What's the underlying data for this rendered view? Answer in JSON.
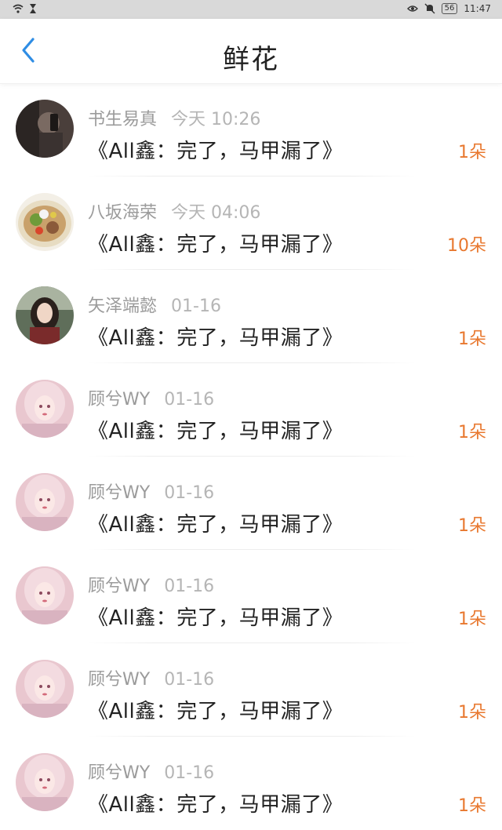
{
  "status_bar": {
    "time": "11:47",
    "battery": "56"
  },
  "navbar": {
    "title": "鲜花"
  },
  "colors": {
    "accent_blue": "#2f8de4",
    "amount_orange": "#e8782f"
  },
  "items": [
    {
      "name": "书生易真",
      "time": "今天 10:26",
      "content": "《All鑫：完了，马甲漏了》",
      "amount": "1朵",
      "avatar": "avatar-dark-portrait"
    },
    {
      "name": "八坂海荣",
      "time": "今天 04:06",
      "content": "《All鑫：完了，马甲漏了》",
      "amount": "10朵",
      "avatar": "avatar-food-plate"
    },
    {
      "name": "矢泽端懿",
      "time": "01-16",
      "content": "《All鑫：完了，马甲漏了》",
      "amount": "1朵",
      "avatar": "avatar-girl-portrait"
    },
    {
      "name": "顾兮WY",
      "time": "01-16",
      "content": "《All鑫：完了，马甲漏了》",
      "amount": "1朵",
      "avatar": "avatar-pink-illustration"
    },
    {
      "name": "顾兮WY",
      "time": "01-16",
      "content": "《All鑫：完了，马甲漏了》",
      "amount": "1朵",
      "avatar": "avatar-pink-illustration"
    },
    {
      "name": "顾兮WY",
      "time": "01-16",
      "content": "《All鑫：完了，马甲漏了》",
      "amount": "1朵",
      "avatar": "avatar-pink-illustration"
    },
    {
      "name": "顾兮WY",
      "time": "01-16",
      "content": "《All鑫：完了，马甲漏了》",
      "amount": "1朵",
      "avatar": "avatar-pink-illustration"
    },
    {
      "name": "顾兮WY",
      "time": "01-16",
      "content": "《All鑫：完了，马甲漏了》",
      "amount": "1朵",
      "avatar": "avatar-pink-illustration"
    }
  ]
}
